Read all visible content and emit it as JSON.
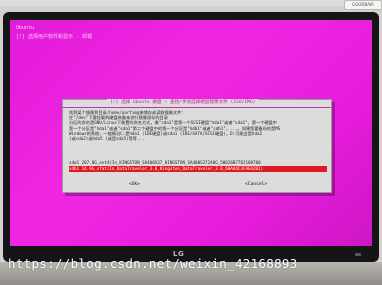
{
  "sticker": {
    "text": "GOODBAIR"
  },
  "screen": {
    "title": "Ubuntu",
    "subtitle": "[!] 选择用户软件和显示 - 卸载"
  },
  "dialog": {
    "title": "[!] 选择 Ubuntu 硬盘 — 查找/手动选择硬盘镜像文件 (ISO/IMG)",
    "body_lines": [
      "找到某个镜像到目录/home/partimg来储存或读取镜像文件：",
      "在\"/dev\"下要挂载的硬盘装备来进行镜像保存的目录",
      "分区的命名是GNU/Linux下装置的命名方式，像\"sda1\"是第一个SCSI硬盘\"hda1\"或者\"sda1\"，第一个硬盘中",
      "第一个分区是\"hda1\"或者\"sda1\"第二个硬盘中的第一个分区是\"hdb1\"或者\"sdb1\"，...。如果您要备份的是MS",
      "Windows的系统，一般情况C:是hda1 (IDE硬盘)或sda1 (IDE/SATA/SCSI硬盘)。D:可能会是hda2",
      "(或sda2)或hda5 (或是sda5)等等..."
    ],
    "devices": [
      {
        "label": "sda1 207.8G_ext4(In_KINGSTON_SA400S37_KINGSTON_SA400S37240G_50026B7782180780",
        "selected": false
      },
      {
        "label": "sdb1 14.9G_vfat(In_DataTraveler_3.0_Kingston_DataTraveler_3.0_60A44C3FAEA2B1)",
        "selected": true
      }
    ],
    "buttons": {
      "ok": "<Ok>",
      "cancel": "<Cancel>"
    }
  },
  "monitor": {
    "brand": "LG"
  },
  "watermark": "https://blog.csdn.net/weixin_42168893",
  "colors": {
    "screen_background": "#e81ddd",
    "dialog_background": "#dcdcdc",
    "selection": "#e01a22",
    "title_accent": "#c4159f"
  }
}
